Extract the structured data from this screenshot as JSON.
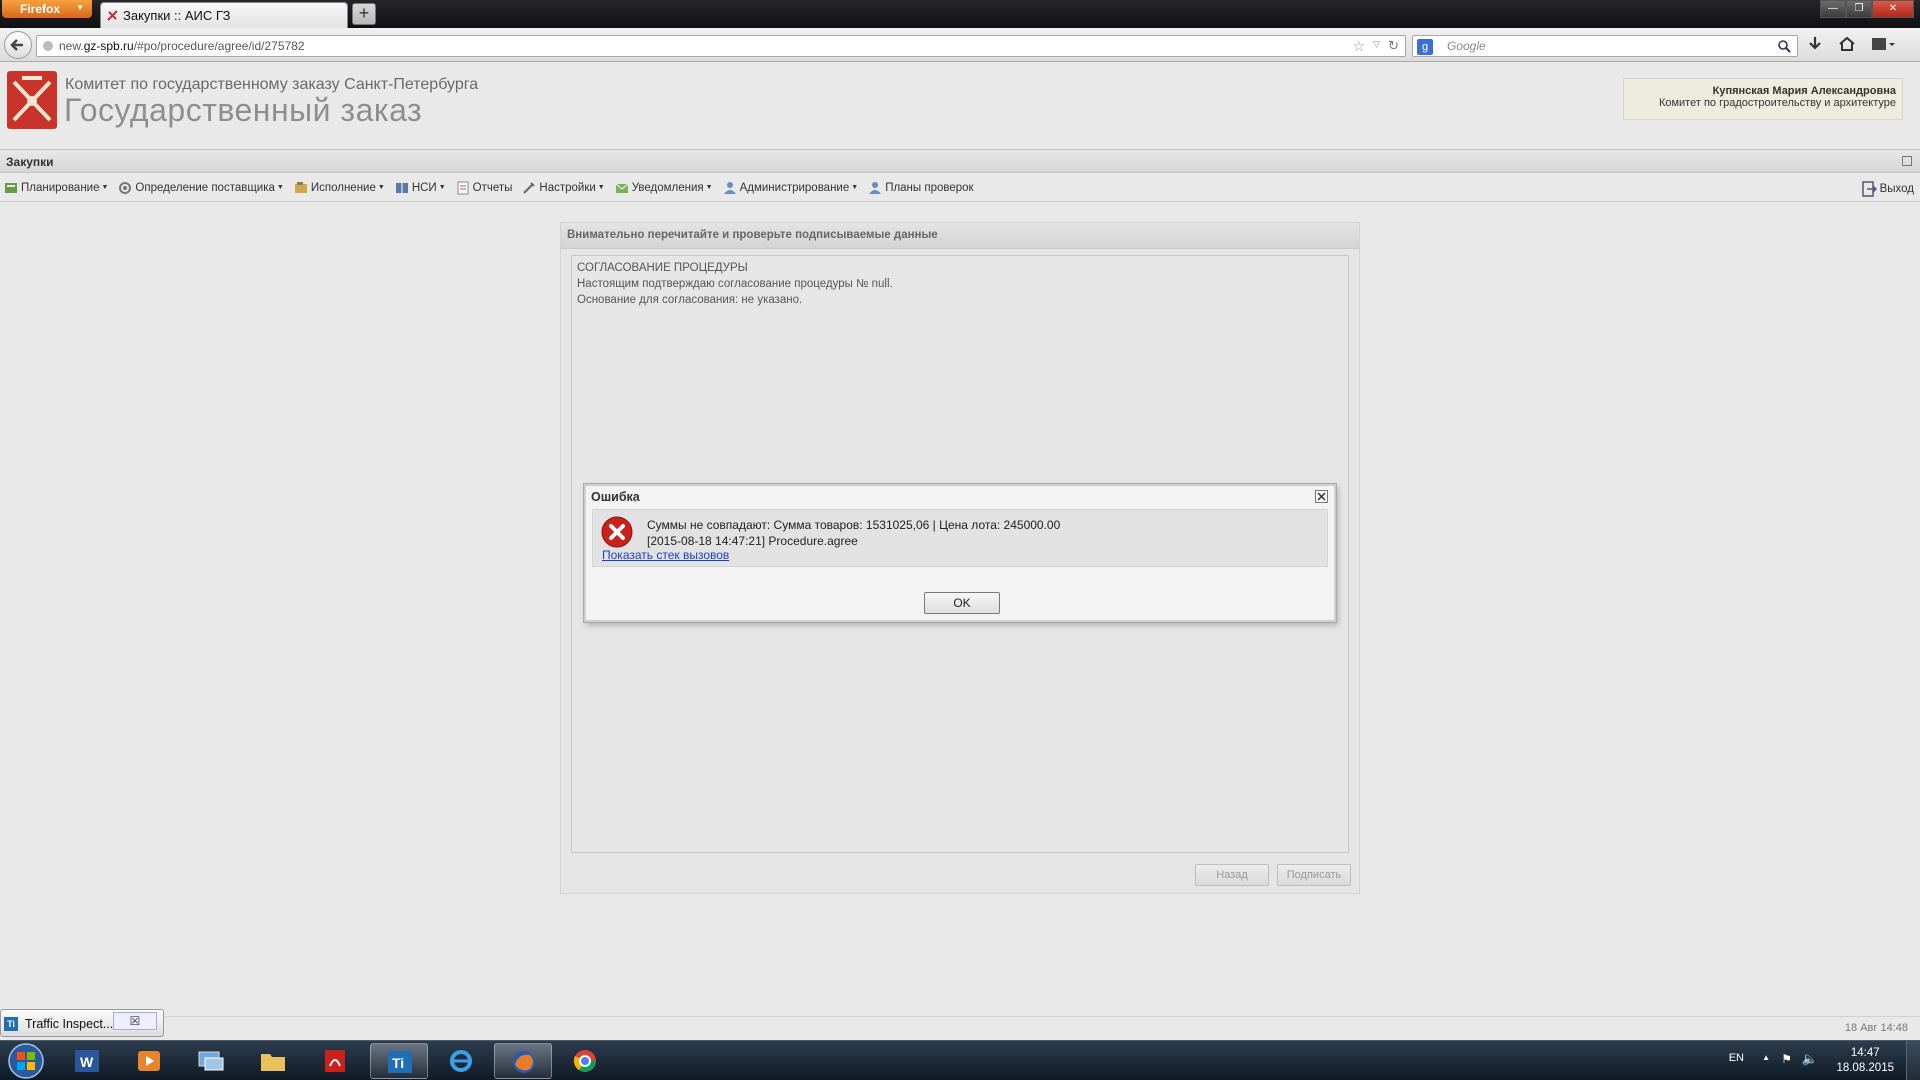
{
  "browser": {
    "menu_button": "Firefox",
    "tab_title": "Закупки :: АИС ГЗ",
    "new_tab": "+",
    "url_prefix": "new.",
    "url_domain": "gz-spb.ru",
    "url_path": "/#po/procedure/agree/id/275782",
    "search_placeholder": "Google"
  },
  "header": {
    "organization": "Комитет по государственному заказу Санкт-Петербурга",
    "system_name": "Государственный заказ",
    "user_name": "Купянская Мария Александровна",
    "user_org": "Комитет по градостроительству и архитектуре"
  },
  "section": {
    "title": "Закупки"
  },
  "menu": {
    "items": [
      {
        "label": "Планирование",
        "icon": "planning-icon",
        "dropdown": true
      },
      {
        "label": "Определение поставщика",
        "icon": "supplier-icon",
        "dropdown": true
      },
      {
        "label": "Исполнение",
        "icon": "execution-icon",
        "dropdown": true
      },
      {
        "label": "НСИ",
        "icon": "reference-book-icon",
        "dropdown": true
      },
      {
        "label": "Отчеты",
        "icon": "report-icon",
        "dropdown": false
      },
      {
        "label": "Настройки",
        "icon": "settings-icon",
        "dropdown": true
      },
      {
        "label": "Уведомления",
        "icon": "notification-icon",
        "dropdown": true
      },
      {
        "label": "Администрирование",
        "icon": "admin-user-icon",
        "dropdown": true
      },
      {
        "label": "Планы проверок",
        "icon": "inspection-plan-icon",
        "dropdown": false
      }
    ],
    "exit_label": "Выход"
  },
  "sign_panel": {
    "title": "Внимательно перечитайте и проверьте подписываемые данные",
    "lines": [
      "СОГЛАСОВАНИЕ ПРОЦЕДУРЫ",
      "Настоящим подтверждаю согласование процедуры № null.",
      "Основание для согласования: не указано."
    ],
    "back_label": "Назад",
    "sign_label": "Подписать"
  },
  "error_dialog": {
    "title": "Ошибка",
    "message": "Суммы не совпадают: Сумма товаров: 1531025,06 | Цена лота: 245000.00",
    "detail": "[2015-08-18 14:47:21] Procedure.agree",
    "stack_link": "Показать стек вызовов",
    "ok_label": "OK"
  },
  "status": {
    "datetime": "18 Авг 14:48"
  },
  "traffic_inspector": {
    "label": "Traffic Inspect...",
    "close": "☒"
  },
  "taskbar": {
    "apps": [
      "word-icon",
      "media-player-icon",
      "remote-desktop-icon",
      "explorer-icon",
      "acrobat-icon",
      "traffic-inspector-icon",
      "internet-explorer-icon",
      "firefox-icon",
      "chrome-icon"
    ],
    "language": "EN",
    "time": "14:47",
    "date": "18.08.2015"
  }
}
